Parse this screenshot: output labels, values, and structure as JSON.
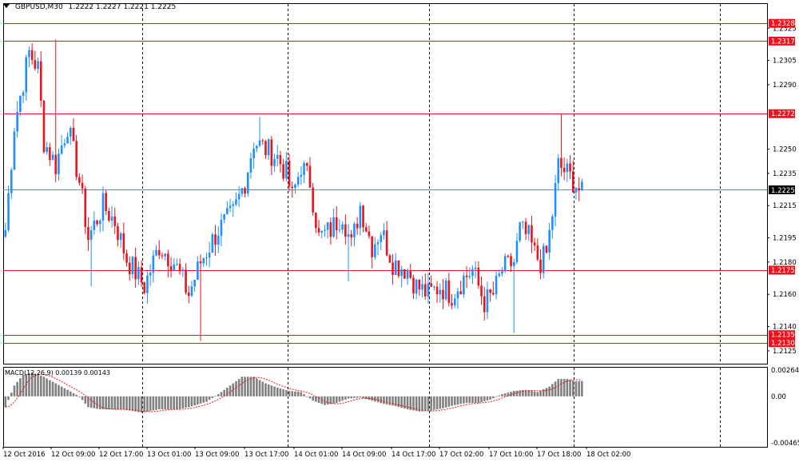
{
  "header": {
    "symbol_label": "GBPUSD,M30",
    "ohlc": "1.2222 1.2227 1.2221 1.2225"
  },
  "macd": {
    "label": "MACD(12,26,9) 0.00139 0.00143"
  },
  "colors": {
    "bull": "#1e90ff",
    "bear": "#e8141e",
    "level_line": "#e8141e",
    "price_line": "#6b8fc4",
    "macd_hist": "#808080",
    "macd_signal": "#e8141e",
    "grid": "#000000"
  },
  "chart_data": [
    {
      "type": "candlestick",
      "symbol": "GBPUSD",
      "timeframe": "M30",
      "ylim": [
        1.2117,
        1.234
      ],
      "y_ticks": [
        1.2325,
        1.2305,
        1.229,
        1.225,
        1.2235,
        1.2215,
        1.2195,
        1.218,
        1.216,
        1.214,
        1.2125
      ],
      "x_tick_labels": [
        "12 Oct 2016",
        "12 Oct 09:00",
        "12 Oct 17:00",
        "13 Oct 01:00",
        "13 Oct 09:00",
        "13 Oct 17:00",
        "14 Oct 01:00",
        "14 Oct 09:00",
        "14 Oct 17:00",
        "17 Oct 02:00",
        "17 Oct 10:00",
        "17 Oct 18:00",
        "18 Oct 02:00"
      ],
      "levels": [
        1.2328,
        1.2317,
        1.2272,
        1.2175,
        1.2135,
        1.213
      ],
      "current_price": 1.2225,
      "close_path": [
        [
          0,
          1.22
        ],
        [
          3,
          1.2265
        ],
        [
          8,
          1.231
        ],
        [
          11,
          1.23
        ],
        [
          13,
          1.2255
        ],
        [
          17,
          1.224
        ],
        [
          21,
          1.2265
        ],
        [
          25,
          1.223
        ],
        [
          28,
          1.2195
        ],
        [
          33,
          1.2215
        ],
        [
          37,
          1.2205
        ],
        [
          41,
          1.2182
        ],
        [
          47,
          1.2165
        ],
        [
          52,
          1.219
        ],
        [
          57,
          1.218
        ],
        [
          62,
          1.216
        ],
        [
          66,
          1.218
        ],
        [
          72,
          1.22
        ],
        [
          77,
          1.221
        ],
        [
          81,
          1.223
        ],
        [
          84,
          1.2255
        ],
        [
          88,
          1.225
        ],
        [
          92,
          1.2245
        ],
        [
          95,
          1.2235
        ],
        [
          97,
          1.222
        ],
        [
          100,
          1.224
        ],
        [
          103,
          1.223
        ],
        [
          106,
          1.2195
        ],
        [
          110,
          1.22
        ],
        [
          114,
          1.221
        ],
        [
          117,
          1.219
        ],
        [
          120,
          1.2215
        ],
        [
          124,
          1.219
        ],
        [
          127,
          1.22
        ],
        [
          131,
          1.218
        ],
        [
          136,
          1.2175
        ],
        [
          139,
          1.2165
        ],
        [
          143,
          1.216
        ],
        [
          147,
          1.2165
        ],
        [
          151,
          1.216
        ],
        [
          155,
          1.217
        ],
        [
          158,
          1.2175
        ],
        [
          162,
          1.2155
        ],
        [
          165,
          1.216
        ],
        [
          168,
          1.2175
        ],
        [
          172,
          1.218
        ],
        [
          174,
          1.22
        ],
        [
          177,
          1.2195
        ],
        [
          179,
          1.2185
        ],
        [
          181,
          1.218
        ],
        [
          183,
          1.2185
        ],
        [
          185,
          1.221
        ],
        [
          187,
          1.224
        ],
        [
          190,
          1.2235
        ],
        [
          193,
          1.2228
        ],
        [
          195,
          1.2222
        ]
      ],
      "series": []
    },
    {
      "type": "macd",
      "ylim": [
        -0.00465,
        0.00264
      ],
      "y_ticks": [
        0.00264,
        0.0,
        -0.00465
      ],
      "macd_path": [
        [
          0,
          -0.001
        ],
        [
          3,
          0.001
        ],
        [
          6,
          0.002
        ],
        [
          9,
          0.0022
        ],
        [
          13,
          0.0018
        ],
        [
          17,
          0.0012
        ],
        [
          21,
          0.0006
        ],
        [
          25,
          0.0
        ],
        [
          28,
          -0.001
        ],
        [
          32,
          -0.0012
        ],
        [
          40,
          -0.0012
        ],
        [
          46,
          -0.0015
        ],
        [
          52,
          -0.0012
        ],
        [
          58,
          -0.0012
        ],
        [
          62,
          -0.001
        ],
        [
          68,
          -0.0005
        ],
        [
          72,
          0.0002
        ],
        [
          76,
          0.001
        ],
        [
          80,
          0.0018
        ],
        [
          84,
          0.0018
        ],
        [
          88,
          0.0012
        ],
        [
          92,
          0.0008
        ],
        [
          96,
          0.0005
        ],
        [
          100,
          0.0004
        ],
        [
          104,
          -0.0004
        ],
        [
          108,
          -0.0008
        ],
        [
          112,
          -0.0006
        ],
        [
          116,
          -0.0002
        ],
        [
          120,
          -0.0001
        ],
        [
          124,
          -0.0004
        ],
        [
          128,
          -0.0007
        ],
        [
          132,
          -0.0009
        ],
        [
          136,
          -0.0012
        ],
        [
          140,
          -0.0014
        ],
        [
          144,
          -0.0013
        ],
        [
          148,
          -0.0011
        ],
        [
          152,
          -0.0008
        ],
        [
          156,
          -0.0006
        ],
        [
          160,
          -0.0006
        ],
        [
          164,
          -0.0003
        ],
        [
          168,
          0.0002
        ],
        [
          172,
          0.0005
        ],
        [
          176,
          0.0006
        ],
        [
          180,
          0.0004
        ],
        [
          184,
          0.0009
        ],
        [
          187,
          0.0016
        ],
        [
          190,
          0.0016
        ],
        [
          193,
          0.0014
        ],
        [
          195,
          0.0014
        ]
      ],
      "signal_lag": 3
    }
  ]
}
